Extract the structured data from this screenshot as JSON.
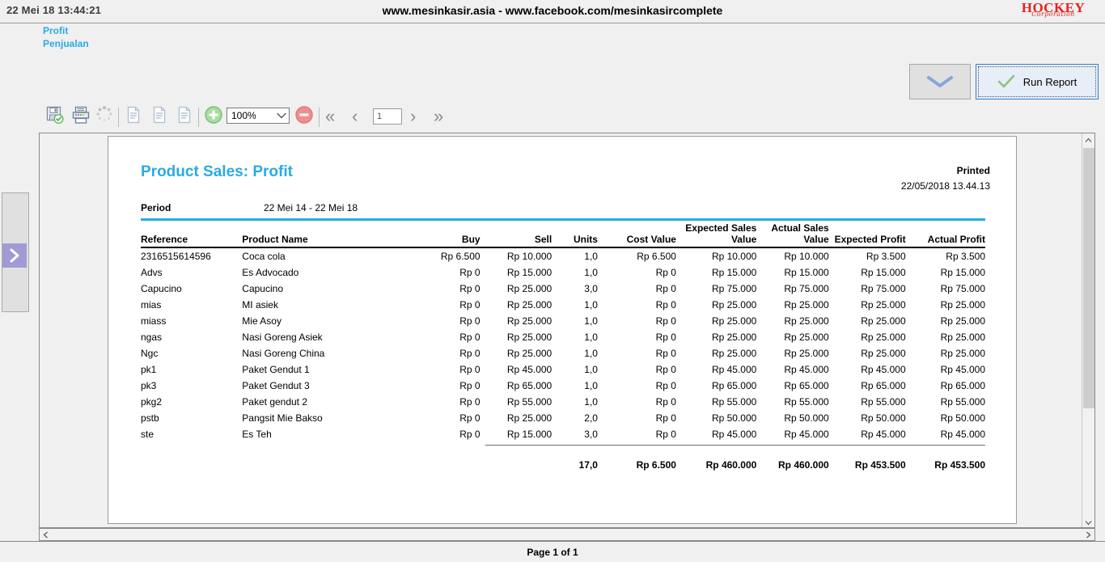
{
  "banner": {
    "date": "22 Mei 18 13:44:21",
    "title": "www.mesinkasir.asia - www.facebook.com/mesinkasircomplete",
    "logo_main": "HOCKEY",
    "logo_sub": "Corporation"
  },
  "breadcrumb": {
    "item1": "Profit",
    "item2": "Penjualan"
  },
  "toolbar": {
    "save_icon": "save-disk-icon",
    "print_icon": "printer-icon",
    "loading_icon": "loading-spinner-icon",
    "export_icon_1": "document-icon",
    "export_icon_2": "document-icon",
    "export_icon_3": "document-icon",
    "zoom_in_icon": "zoom-in-plus-icon",
    "zoom_out_icon": "zoom-out-minus-icon",
    "zoom_value": "100%",
    "page_value": "1",
    "nav_first": "«",
    "nav_prev": "‹",
    "nav_next": "›",
    "nav_last": "»"
  },
  "actions": {
    "collapse_icon": "chevron-down-icon",
    "run_report_label": "Run Report",
    "run_report_icon": "green-check-icon"
  },
  "splitter": {
    "expand_icon": "chevron-right-icon"
  },
  "scrollbars": {
    "up_icon": "chevron-up-icon",
    "down_icon": "chevron-down-icon",
    "left_icon": "chevron-left-icon",
    "right_icon": "chevron-right-icon"
  },
  "status": {
    "page_info": "Page 1 of 1"
  },
  "report": {
    "title": "Product Sales: Profit",
    "printed_label": "Printed",
    "printed_value": "22/05/2018 13.44.13",
    "period_label": "Period",
    "period_value": "22 Mei 14 - 22 Mei 18",
    "accent_color": "#29abe2",
    "columns": [
      "Reference",
      "Product Name",
      "Buy",
      "Sell",
      "Units",
      "Cost Value",
      "Expected Sales Value",
      "Actual Sales Value",
      "Expected Profit",
      "Actual Profit"
    ],
    "rows": [
      {
        "reference": "2316515614596",
        "product": "Coca cola",
        "buy": "Rp 6.500",
        "sell": "Rp 10.000",
        "units": "1,0",
        "cost": "Rp 6.500",
        "expected_sales": "Rp 10.000",
        "actual_sales": "Rp 10.000",
        "expected_profit": "Rp 3.500",
        "actual_profit": "Rp 3.500"
      },
      {
        "reference": "Advs",
        "product": "Es Advocado",
        "buy": "Rp 0",
        "sell": "Rp 15.000",
        "units": "1,0",
        "cost": "Rp 0",
        "expected_sales": "Rp 15.000",
        "actual_sales": "Rp 15.000",
        "expected_profit": "Rp 15.000",
        "actual_profit": "Rp 15.000"
      },
      {
        "reference": "Capucino",
        "product": "Capucino",
        "buy": "Rp 0",
        "sell": "Rp 25.000",
        "units": "3,0",
        "cost": "Rp 0",
        "expected_sales": "Rp 75.000",
        "actual_sales": "Rp 75.000",
        "expected_profit": "Rp 75.000",
        "actual_profit": "Rp 75.000"
      },
      {
        "reference": "mias",
        "product": "MI asiek",
        "buy": "Rp 0",
        "sell": "Rp 25.000",
        "units": "1,0",
        "cost": "Rp 0",
        "expected_sales": "Rp 25.000",
        "actual_sales": "Rp 25.000",
        "expected_profit": "Rp 25.000",
        "actual_profit": "Rp 25.000"
      },
      {
        "reference": "miass",
        "product": "Mie Asoy",
        "buy": "Rp 0",
        "sell": "Rp 25.000",
        "units": "1,0",
        "cost": "Rp 0",
        "expected_sales": "Rp 25.000",
        "actual_sales": "Rp 25.000",
        "expected_profit": "Rp 25.000",
        "actual_profit": "Rp 25.000"
      },
      {
        "reference": "ngas",
        "product": "Nasi Goreng Asiek",
        "buy": "Rp 0",
        "sell": "Rp 25.000",
        "units": "1,0",
        "cost": "Rp 0",
        "expected_sales": "Rp 25.000",
        "actual_sales": "Rp 25.000",
        "expected_profit": "Rp 25.000",
        "actual_profit": "Rp 25.000"
      },
      {
        "reference": "Ngc",
        "product": "Nasi Goreng China",
        "buy": "Rp 0",
        "sell": "Rp 25.000",
        "units": "1,0",
        "cost": "Rp 0",
        "expected_sales": "Rp 25.000",
        "actual_sales": "Rp 25.000",
        "expected_profit": "Rp 25.000",
        "actual_profit": "Rp 25.000"
      },
      {
        "reference": "pk1",
        "product": "Paket Gendut 1",
        "buy": "Rp 0",
        "sell": "Rp 45.000",
        "units": "1,0",
        "cost": "Rp 0",
        "expected_sales": "Rp 45.000",
        "actual_sales": "Rp 45.000",
        "expected_profit": "Rp 45.000",
        "actual_profit": "Rp 45.000"
      },
      {
        "reference": "pk3",
        "product": "Paket Gendut 3",
        "buy": "Rp 0",
        "sell": "Rp 65.000",
        "units": "1,0",
        "cost": "Rp 0",
        "expected_sales": "Rp 65.000",
        "actual_sales": "Rp 65.000",
        "expected_profit": "Rp 65.000",
        "actual_profit": "Rp 65.000"
      },
      {
        "reference": "pkg2",
        "product": "Paket gendut 2",
        "buy": "Rp 0",
        "sell": "Rp 55.000",
        "units": "1,0",
        "cost": "Rp 0",
        "expected_sales": "Rp 55.000",
        "actual_sales": "Rp 55.000",
        "expected_profit": "Rp 55.000",
        "actual_profit": "Rp 55.000"
      },
      {
        "reference": "pstb",
        "product": "Pangsit Mie Bakso",
        "buy": "Rp 0",
        "sell": "Rp 25.000",
        "units": "2,0",
        "cost": "Rp 0",
        "expected_sales": "Rp 50.000",
        "actual_sales": "Rp 50.000",
        "expected_profit": "Rp 50.000",
        "actual_profit": "Rp 50.000"
      },
      {
        "reference": "ste",
        "product": "Es Teh",
        "buy": "Rp 0",
        "sell": "Rp 15.000",
        "units": "3,0",
        "cost": "Rp 0",
        "expected_sales": "Rp 45.000",
        "actual_sales": "Rp 45.000",
        "expected_profit": "Rp 45.000",
        "actual_profit": "Rp 45.000"
      }
    ],
    "totals": {
      "reference": "",
      "product": "",
      "buy": "",
      "sell": "",
      "units": "17,0",
      "cost": "Rp 6.500",
      "expected_sales": "Rp 460.000",
      "actual_sales": "Rp 460.000",
      "expected_profit": "Rp 453.500",
      "actual_profit": "Rp 453.500"
    }
  }
}
